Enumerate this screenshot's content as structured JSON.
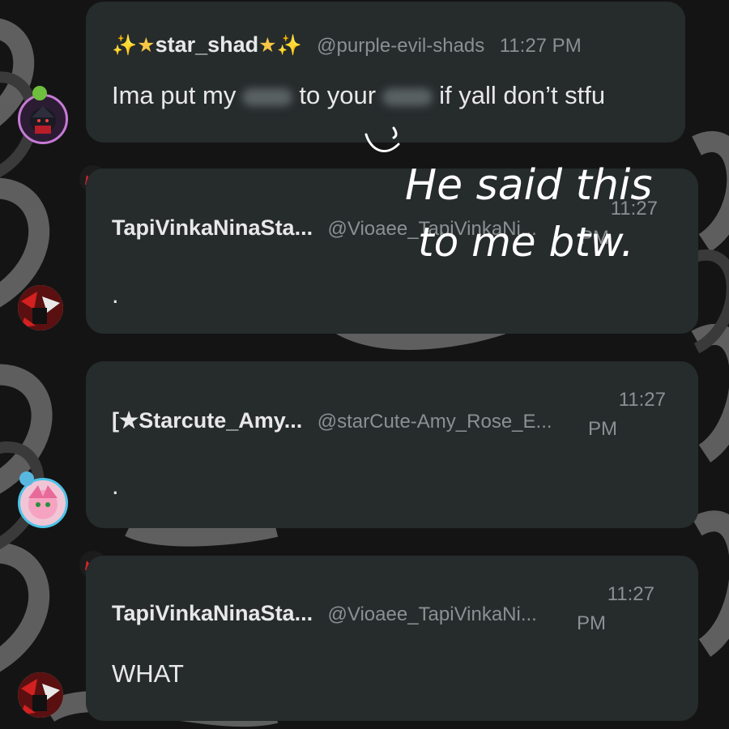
{
  "messages": [
    {
      "name": "star_shad",
      "handle": "@purple-evil-shads",
      "time": "11:27 PM",
      "text_1": "Ima put my",
      "text_2": "to your",
      "text_3": "if yall don’t stfu"
    },
    {
      "name": "TapiVinkaNinaSta...",
      "handle": "@Vioaee_TapiVinkaNi...",
      "time_line1": "11:27",
      "time_line2": "PM",
      "text": "."
    },
    {
      "name": "[★Starcute_Amy...",
      "handle": "@starCute-Amy_Rose_E...",
      "time_line1": "11:27",
      "time_line2": "PM",
      "text": "."
    },
    {
      "name": "TapiVinkaNinaSta...",
      "handle": "@Vioaee_TapiVinkaNi...",
      "time_line1": "11:27",
      "time_line2": "PM",
      "text": "WHAT"
    }
  ],
  "annotation": {
    "line1": "He said this",
    "line2": "to me btw."
  },
  "colors": {
    "bubble": "#262b2c",
    "name": "#e8e8e8",
    "handle": "#8b9092",
    "crown": "#e0242c",
    "sparkles": "#f6c744"
  },
  "icons": [
    "sparkles-icon",
    "star-icon",
    "crown-icon"
  ]
}
